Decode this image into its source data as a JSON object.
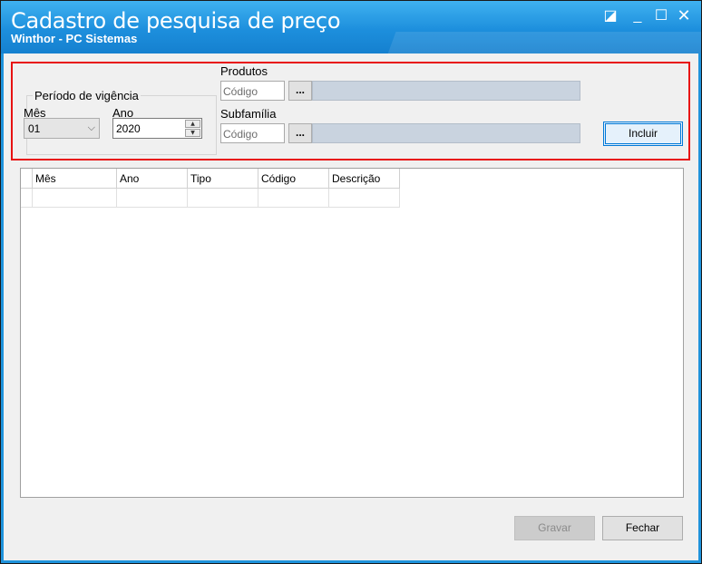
{
  "window": {
    "title": "Cadastro de pesquisa de preço",
    "subtitle": "Winthor - PC Sistemas",
    "controls": {
      "restore": "◪",
      "minimize": "_",
      "maximize": "☐",
      "close": "✕"
    }
  },
  "filters": {
    "periodo_legend": "Período de vigência",
    "mes_label": "Mês",
    "mes_value": "01",
    "ano_label": "Ano",
    "ano_value": "2020",
    "produtos_label": "Produtos",
    "produtos_placeholder": "Código",
    "subfamilia_label": "Subfamília",
    "subfamilia_placeholder": "Código",
    "browse_label": "...",
    "incluir_label": "Incluir"
  },
  "grid": {
    "columns": [
      "Mês",
      "Ano",
      "Tipo",
      "Código",
      "Descrição"
    ]
  },
  "footer": {
    "gravar_label": "Gravar",
    "fechar_label": "Fechar"
  },
  "colors": {
    "titlebar": "#1d8fdd",
    "highlight_border": "#e81212",
    "desc_bar": "#c9d3df",
    "focus_border": "#0078d7"
  }
}
